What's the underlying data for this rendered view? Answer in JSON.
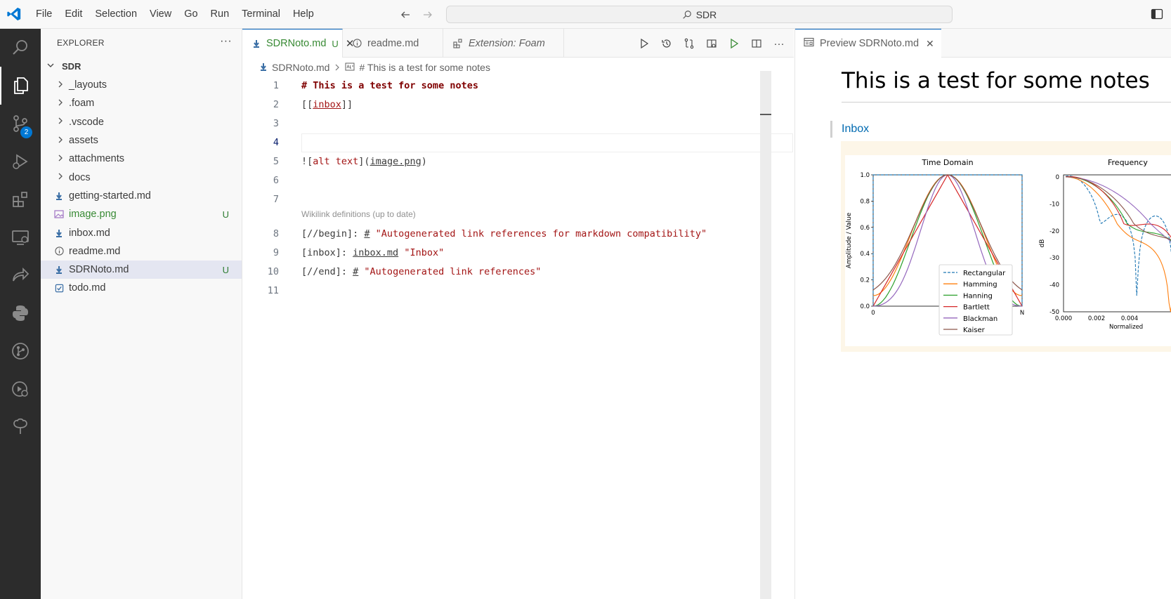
{
  "menu": [
    "File",
    "Edit",
    "Selection",
    "View",
    "Go",
    "Run",
    "Terminal",
    "Help"
  ],
  "command_center": "SDR",
  "activity_badge": "2",
  "explorer": {
    "title": "EXPLORER",
    "root": "SDR",
    "items": [
      {
        "name": "_layouts",
        "type": "folder",
        "git": ""
      },
      {
        "name": ".foam",
        "type": "folder",
        "git": ""
      },
      {
        "name": ".vscode",
        "type": "folder",
        "git": ""
      },
      {
        "name": "assets",
        "type": "folder",
        "git": ""
      },
      {
        "name": "attachments",
        "type": "folder",
        "git": ""
      },
      {
        "name": "docs",
        "type": "folder",
        "git": ""
      },
      {
        "name": "getting-started.md",
        "type": "markdown",
        "git": ""
      },
      {
        "name": "image.png",
        "type": "image",
        "git": "U"
      },
      {
        "name": "inbox.md",
        "type": "markdown",
        "git": ""
      },
      {
        "name": "readme.md",
        "type": "info",
        "git": ""
      },
      {
        "name": "SDRNoto.md",
        "type": "markdown",
        "git": "U"
      },
      {
        "name": "todo.md",
        "type": "todo",
        "git": ""
      }
    ]
  },
  "tabs": {
    "t1": {
      "label": "SDRNoto.md",
      "mod": "U"
    },
    "t2": {
      "label": "readme.md"
    },
    "t3": {
      "label": "Extension: Foam"
    }
  },
  "breadcrumb": {
    "file": "SDRNoto.md",
    "symbol": "# This is a test for some notes"
  },
  "code": {
    "numbers": [
      "1",
      "2",
      "3",
      "4",
      "5",
      "6",
      "7",
      "8",
      "9",
      "10",
      "11"
    ],
    "l1": "# This is a test for some notes",
    "l2_open": "[[",
    "l2_link": "inbox",
    "l2_close": "]]",
    "l5_a": "![",
    "l5_alt": "alt text",
    "l5_b": "](",
    "l5_url": "image.png",
    "l5_c": ")",
    "codelens": "Wikilink definitions (up to date)",
    "l8_a": "[//begin]: ",
    "l8_hash": "#",
    "l8_str": " \"Autogenerated link references for markdown compatibility\"",
    "l9_a": "[inbox]: ",
    "l9_url": "inbox.md",
    "l9_str": " \"Inbox\"",
    "l10_a": "[//end]: ",
    "l10_hash": "#",
    "l10_str": " \"Autogenerated link references\""
  },
  "preview": {
    "tab_label": "Preview SDRNoto.md",
    "heading": "This is a test for some notes",
    "quote_link": "Inbox"
  },
  "chart_data": {
    "type": "line",
    "panels": [
      {
        "title": "Time Domain",
        "ylabel": "Amplitude / Value",
        "xticks": [
          "0",
          "N"
        ],
        "yticks": [
          "0.0",
          "0.2",
          "0.4",
          "0.6",
          "0.8",
          "1.0"
        ],
        "legend": [
          "Rectangular",
          "Hamming",
          "Hanning",
          "Bartlett",
          "Blackman",
          "Kaiser"
        ]
      },
      {
        "title": "Frequency",
        "ylabel": "dB",
        "xlabel": "Normalized",
        "xticks": [
          "0.000",
          "0.002",
          "0.004"
        ],
        "yticks": [
          "0",
          "-10",
          "-20",
          "-30",
          "-40",
          "-50"
        ]
      }
    ],
    "series_colors": {
      "Rectangular": "#1f77b4",
      "Hamming": "#ff7f0e",
      "Hanning": "#2ca02c",
      "Bartlett": "#d62728",
      "Blackman": "#9467bd",
      "Kaiser": "#8c564b"
    }
  }
}
